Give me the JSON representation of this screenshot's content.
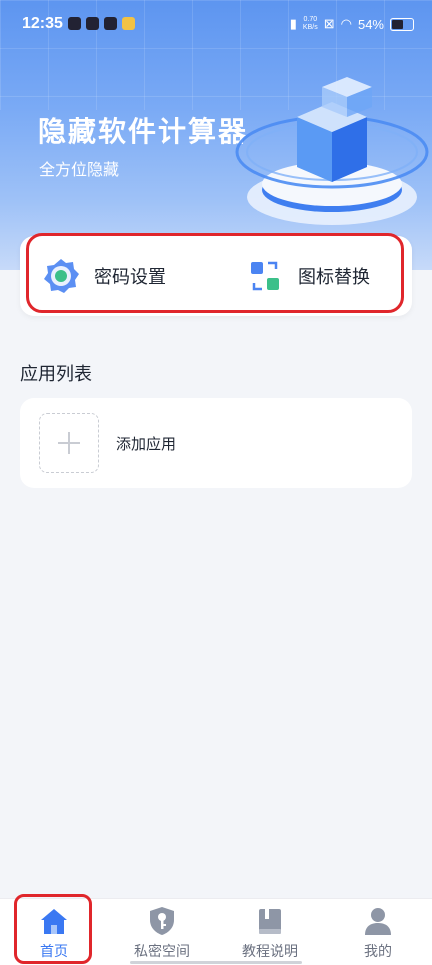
{
  "status_bar": {
    "time": "12:35",
    "net_speed_value": "0.70",
    "net_speed_unit": "KB/s",
    "battery": "54%"
  },
  "hero": {
    "title": "隐藏软件计算器",
    "subtitle": "全方位隐藏"
  },
  "quick_actions": [
    {
      "label": "密码设置",
      "icon": "gear-icon"
    },
    {
      "label": "图标替换",
      "icon": "swap-icon"
    }
  ],
  "app_list": {
    "title": "应用列表",
    "add_label": "添加应用"
  },
  "tabbar": {
    "tabs": [
      {
        "label": "首页",
        "icon": "home-icon",
        "active": true
      },
      {
        "label": "私密空间",
        "icon": "shield-key-icon",
        "active": false
      },
      {
        "label": "教程说明",
        "icon": "book-icon",
        "active": false
      },
      {
        "label": "我的",
        "icon": "user-icon",
        "active": false
      }
    ]
  },
  "colors": {
    "accent": "#3a78f2",
    "highlight": "#e0262b",
    "background": "#f3f5f9"
  }
}
